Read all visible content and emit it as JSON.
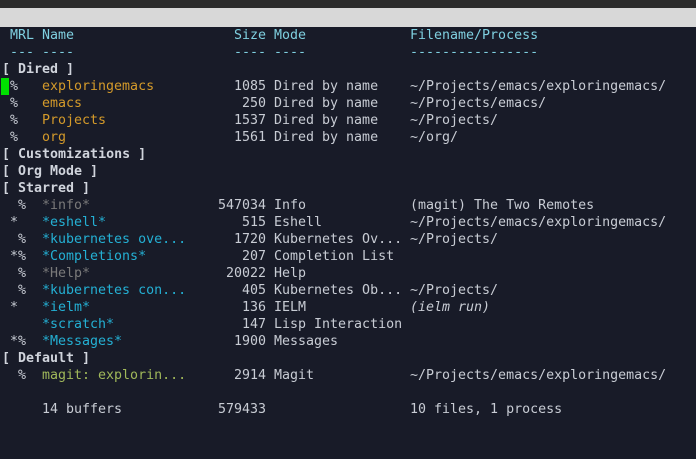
{
  "header": {
    "mrl": "MRL",
    "name": "Name",
    "size": "Size",
    "mode": "Mode",
    "file": "Filename/Process"
  },
  "underline": {
    "mrl": "---",
    "name": "----",
    "size": "----",
    "mode": "----",
    "file": "----------------"
  },
  "lines": [
    {
      "type": "group",
      "label": "[ Dired ]"
    },
    {
      "type": "buffer",
      "mrl": "%",
      "name": "exploringemacs",
      "size": "1085",
      "mode": "Dired by name",
      "file": "~/Projects/emacs/exploringemacs/",
      "kind": "dired",
      "cursor": true
    },
    {
      "type": "buffer",
      "mrl": "%",
      "name": "emacs",
      "size": "250",
      "mode": "Dired by name",
      "file": "~/Projects/emacs/",
      "kind": "dired"
    },
    {
      "type": "buffer",
      "mrl": "%",
      "name": "Projects",
      "size": "1537",
      "mode": "Dired by name",
      "file": "~/Projects/",
      "kind": "dired"
    },
    {
      "type": "buffer",
      "mrl": "%",
      "name": "org",
      "size": "1561",
      "mode": "Dired by name",
      "file": "~/org/",
      "kind": "dired"
    },
    {
      "type": "group",
      "label": "[ Customizations ]"
    },
    {
      "type": "group",
      "label": "[ Org Mode ]"
    },
    {
      "type": "group",
      "label": "[ Starred ]"
    },
    {
      "type": "buffer",
      "mrl": " %",
      "name": "*info*",
      "size": "547034",
      "mode": "Info",
      "file": "(magit) The Two Remotes",
      "kind": "dim"
    },
    {
      "type": "buffer",
      "mrl": "*",
      "name": "*eshell*",
      "size": "515",
      "mode": "Eshell",
      "file": "~/Projects/emacs/exploringemacs/",
      "kind": "special"
    },
    {
      "type": "buffer",
      "mrl": " %",
      "name": "*kubernetes ove...",
      "size": "1720",
      "mode": "Kubernetes Ov...",
      "file": "~/Projects/",
      "kind": "special"
    },
    {
      "type": "buffer",
      "mrl": "*%",
      "name": "*Completions*",
      "size": "207",
      "mode": "Completion List",
      "file": "",
      "kind": "special"
    },
    {
      "type": "buffer",
      "mrl": " %",
      "name": "*Help*",
      "size": "20022",
      "mode": "Help",
      "file": "",
      "kind": "dim"
    },
    {
      "type": "buffer",
      "mrl": " %",
      "name": "*kubernetes con...",
      "size": "405",
      "mode": "Kubernetes Ob...",
      "file": "~/Projects/",
      "kind": "special"
    },
    {
      "type": "buffer",
      "mrl": "*",
      "name": "*ielm*",
      "size": "136",
      "mode": "IELM",
      "file": "(ielm run)",
      "kind": "special",
      "file_italic": true
    },
    {
      "type": "buffer",
      "mrl": "",
      "name": "*scratch*",
      "size": "147",
      "mode": "Lisp Interaction",
      "file": "",
      "kind": "special"
    },
    {
      "type": "buffer",
      "mrl": "*%",
      "name": "*Messages*",
      "size": "1900",
      "mode": "Messages",
      "file": "",
      "kind": "special"
    },
    {
      "type": "group",
      "label": "[ Default ]"
    },
    {
      "type": "buffer",
      "mrl": " %",
      "name": "magit: explorin...",
      "size": "2914",
      "mode": "Magit",
      "file": "~/Projects/emacs/exploringemacs/",
      "kind": "magit"
    },
    {
      "type": "blank"
    },
    {
      "type": "summary",
      "name": "14 buffers",
      "size": "579433",
      "file": "10 files, 1 process"
    }
  ],
  "colors": {
    "background": "#181b28",
    "dired": "#d49a2a",
    "special": "#24b0d4",
    "dim": "#7a7a7a",
    "magit": "#a0b85a",
    "cursor": "#00e000"
  }
}
